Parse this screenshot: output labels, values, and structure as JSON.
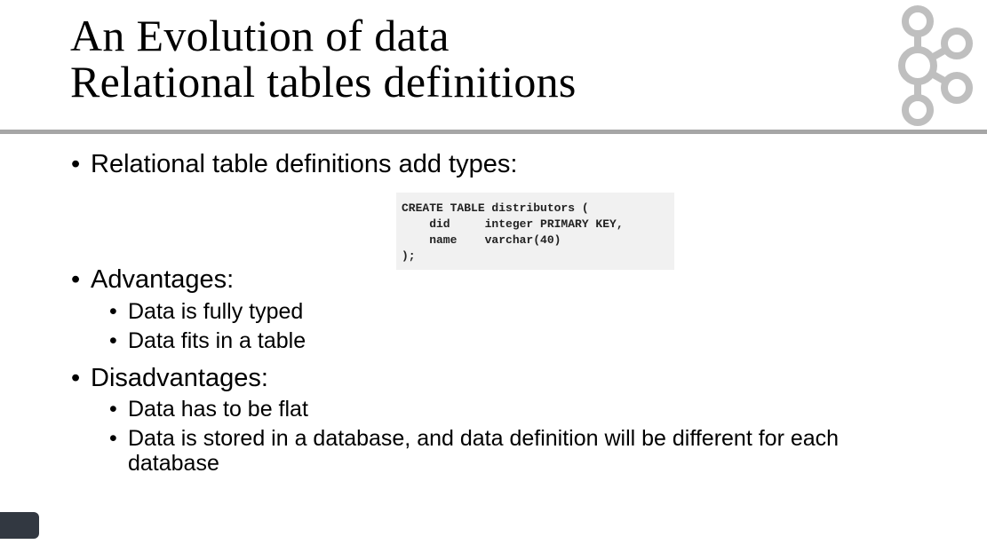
{
  "slide": {
    "title_line1": "An Evolution of data",
    "title_line2": "Relational tables definitions",
    "bullets": {
      "intro": "Relational table definitions add types:",
      "advantages": "Advantages:",
      "adv_typed": "Data is fully typed",
      "adv_table": "Data fits in a table",
      "disadvantages": "Disadvantages:",
      "dis_flat": "Data has to be flat",
      "dis_db_line1": "Data is stored in a database, and data definition will be different for each",
      "dis_db_line2": "database"
    },
    "bullet_glyph": "•",
    "code_snippet": "CREATE TABLE distributors (\n    did     integer PRIMARY KEY,\n    name    varchar(40)\n);"
  },
  "logo": {
    "icon": "kafka-logo-icon",
    "color": "#bfbfbf"
  },
  "colors": {
    "rule": "#a6a6a6",
    "code_bg": "#f1f1f1",
    "corner_tab": "#323841"
  }
}
